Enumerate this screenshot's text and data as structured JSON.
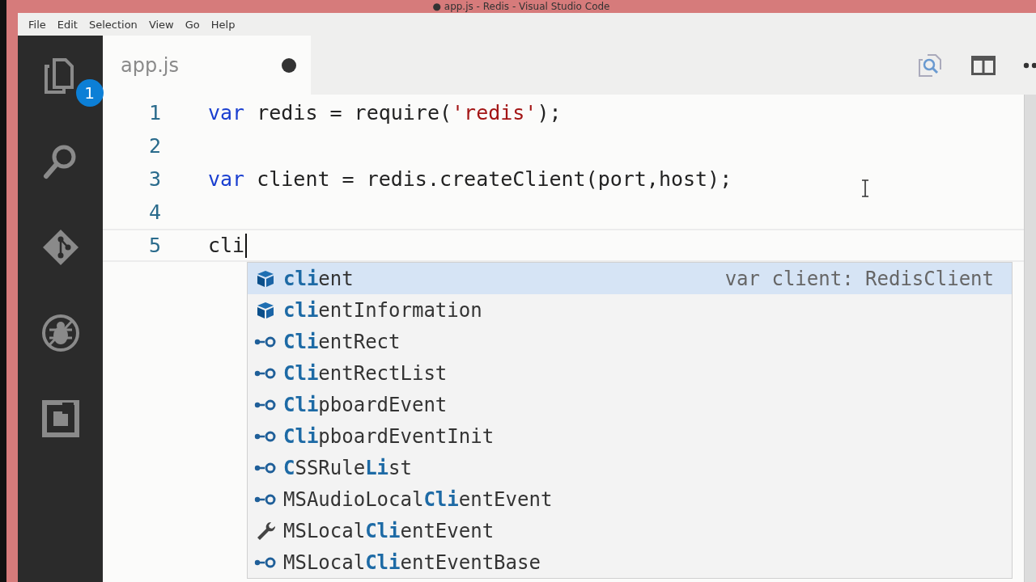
{
  "window": {
    "title": "● app.js - Redis - Visual Studio Code"
  },
  "menu": [
    "File",
    "Edit",
    "Selection",
    "View",
    "Go",
    "Help"
  ],
  "activity_bar": [
    {
      "kind": "files",
      "badge": "1"
    },
    {
      "kind": "search"
    },
    {
      "kind": "git"
    },
    {
      "kind": "debug"
    },
    {
      "kind": "extensions"
    }
  ],
  "tabs": [
    {
      "label": "app.js",
      "selected": true,
      "dirty": true
    }
  ],
  "editor": {
    "lines": [
      {
        "number": "1",
        "tokens": [
          {
            "kind": "keyword",
            "text": "var"
          },
          {
            "kind": "plain",
            "text": " redis = require("
          },
          {
            "kind": "string",
            "text": "'redis'"
          },
          {
            "kind": "plain",
            "text": ");"
          }
        ]
      },
      {
        "number": "2"
      },
      {
        "number": "3",
        "tokens": [
          {
            "kind": "keyword",
            "text": "var"
          },
          {
            "kind": "plain",
            "text": " client = redis.createClient(port,host);"
          }
        ]
      },
      {
        "number": "4"
      },
      {
        "number": "5",
        "tokens": [
          {
            "kind": "plain",
            "text": "cli"
          }
        ],
        "cursor": true
      }
    ]
  },
  "suggestions": [
    {
      "kind": "variable",
      "label": "**cli**ent",
      "detail": "var client: RedisClient",
      "selected": true
    },
    {
      "kind": "variable",
      "label": "**cli**entInformation",
      "selected": false
    },
    {
      "kind": "class",
      "label": "**Cli**entRect",
      "selected": false
    },
    {
      "kind": "class",
      "label": "**Cli**entRectList",
      "selected": false
    },
    {
      "kind": "class",
      "label": "**Cli**pboardEvent",
      "selected": false
    },
    {
      "kind": "class",
      "label": "**Cli**pboardEventInit",
      "selected": false
    },
    {
      "kind": "class",
      "label": "**C**SSRule**Li**st",
      "selected": false
    },
    {
      "kind": "class",
      "label": "MSAudioLocal**Cli**entEvent",
      "selected": false
    },
    {
      "kind": "snippet",
      "label": "MSLocal**Cli**entEvent",
      "selected": false
    },
    {
      "kind": "class",
      "label": "MSLocal**Cli**entEventBase",
      "selected": false
    }
  ]
}
